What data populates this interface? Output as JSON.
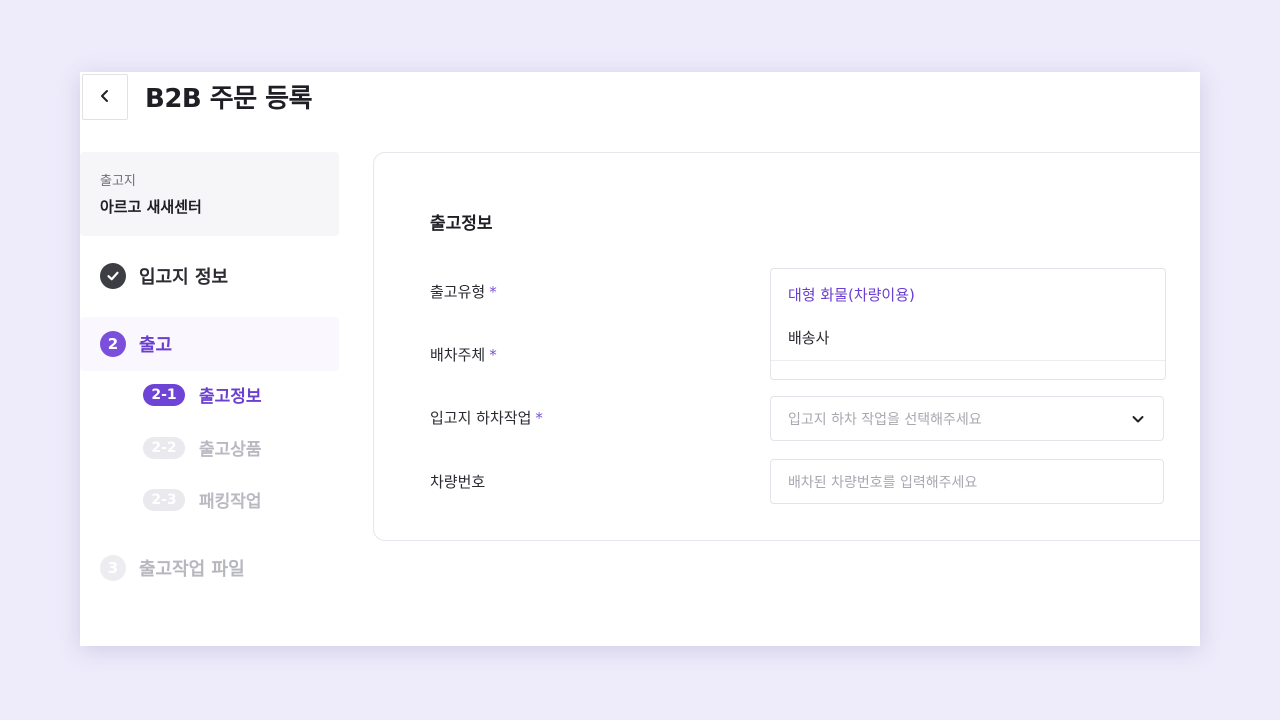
{
  "header": {
    "title": "B2B 주문 등록",
    "back_icon": "chevron-left-icon"
  },
  "sidebar": {
    "origin": {
      "label": "출고지",
      "value": "아르고 새새센터"
    },
    "steps": [
      {
        "number": "✓",
        "label": "입고지 정보",
        "state": "done",
        "icon": "check-icon"
      },
      {
        "number": "2",
        "label": "출고",
        "state": "active",
        "substeps": [
          {
            "number": "2-1",
            "label": "출고정보",
            "state": "active"
          },
          {
            "number": "2-2",
            "label": "출고상품",
            "state": "inactive"
          },
          {
            "number": "2-3",
            "label": "패킹작업",
            "state": "inactive"
          }
        ]
      },
      {
        "number": "3",
        "label": "출고작업 파일",
        "state": "inactive"
      }
    ]
  },
  "form": {
    "section_title": "출고정보",
    "required_mark": "*",
    "fields": {
      "type": {
        "label": "출고유형",
        "required": true
      },
      "dispatcher": {
        "label": "배차주체",
        "required": true
      },
      "unload": {
        "label": "입고지 하차작업",
        "required": true,
        "placeholder": "입고지 하차 작업을 선택해주세요"
      },
      "vehicle": {
        "label": "차량번호",
        "required": false,
        "placeholder": "배차된 차량번호를 입력해주세요"
      }
    },
    "dropdown_options": [
      {
        "label": "대형 화물(차량이용)",
        "selected": true
      },
      {
        "label": "배송사",
        "selected": false
      }
    ]
  },
  "colors": {
    "accent": "#6a3fd1",
    "background": "#eeecfb",
    "done_step": "#3d3d44",
    "inactive": "#b9b9c1"
  }
}
